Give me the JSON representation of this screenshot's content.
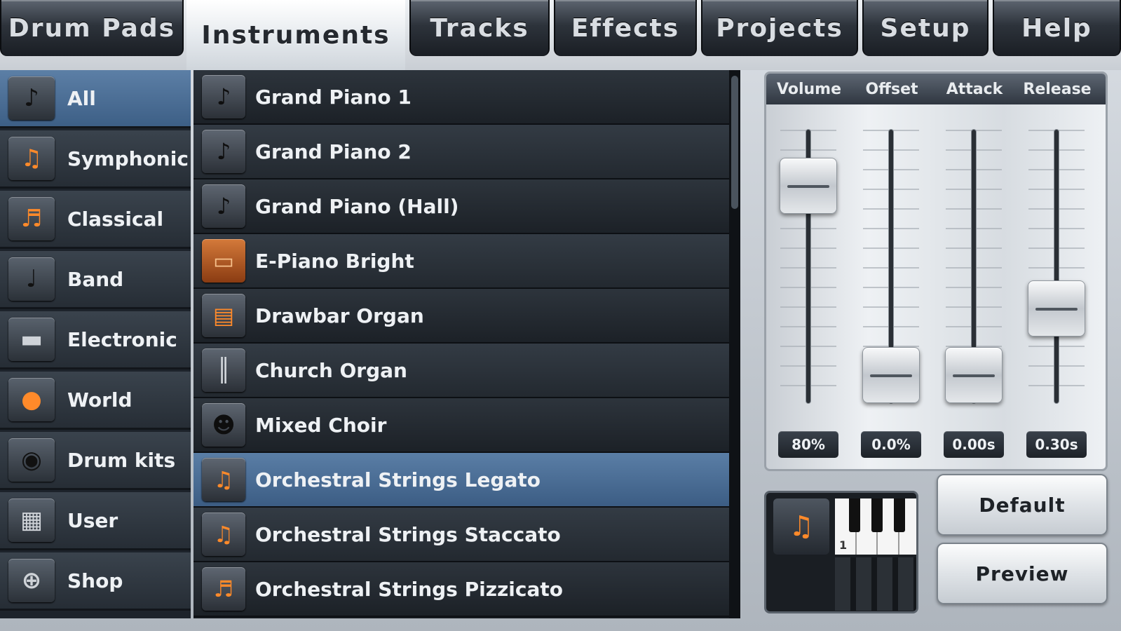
{
  "tabs": [
    {
      "label": "Drum Pads"
    },
    {
      "label": "Instruments"
    },
    {
      "label": "Tracks"
    },
    {
      "label": "Effects"
    },
    {
      "label": "Projects"
    },
    {
      "label": "Setup"
    },
    {
      "label": "Help"
    }
  ],
  "active_tab": "Instruments",
  "categories": [
    {
      "label": "All",
      "icon": "grand-piano-icon"
    },
    {
      "label": "Symphonic",
      "icon": "violin-icon"
    },
    {
      "label": "Classical",
      "icon": "violin-icon"
    },
    {
      "label": "Band",
      "icon": "guitar-icon"
    },
    {
      "label": "Electronic",
      "icon": "synth-icon"
    },
    {
      "label": "World",
      "icon": "drum-icon"
    },
    {
      "label": "Drum kits",
      "icon": "drum-kit-icon"
    },
    {
      "label": "User",
      "icon": "keyboard-icon"
    },
    {
      "label": "Shop",
      "icon": "cart-icon"
    }
  ],
  "active_category": "All",
  "instruments": [
    {
      "label": "Grand Piano 1",
      "icon": "grand-piano-icon"
    },
    {
      "label": "Grand Piano 2",
      "icon": "grand-piano-icon"
    },
    {
      "label": "Grand Piano (Hall)",
      "icon": "grand-piano-icon"
    },
    {
      "label": "E-Piano Bright",
      "icon": "e-piano-icon"
    },
    {
      "label": "Drawbar Organ",
      "icon": "organ-icon"
    },
    {
      "label": "Church Organ",
      "icon": "pipe-organ-icon"
    },
    {
      "label": "Mixed Choir",
      "icon": "choir-icon"
    },
    {
      "label": "Orchestral Strings Legato",
      "icon": "strings-icon"
    },
    {
      "label": "Orchestral Strings Staccato",
      "icon": "strings-icon"
    },
    {
      "label": "Orchestral Strings Pizzicato",
      "icon": "strings-icon"
    }
  ],
  "selected_instrument": "Orchestral Strings Legato",
  "mixer": {
    "sliders": [
      {
        "label": "Volume",
        "value": "80%",
        "level": 0.8
      },
      {
        "label": "Offset",
        "value": "0.0%",
        "level": 0.0
      },
      {
        "label": "Attack",
        "value": "0.00s",
        "level": 0.0
      },
      {
        "label": "Release",
        "value": "0.30s",
        "level": 0.3
      }
    ]
  },
  "preview": {
    "instrument_icon": "strings-icon",
    "key_label": "1"
  },
  "buttons": {
    "default_label": "Default",
    "preview_label": "Preview"
  },
  "colors": {
    "accent_selected": "#4a6e96",
    "instrument_icon_orange": "#ff8a2a"
  }
}
